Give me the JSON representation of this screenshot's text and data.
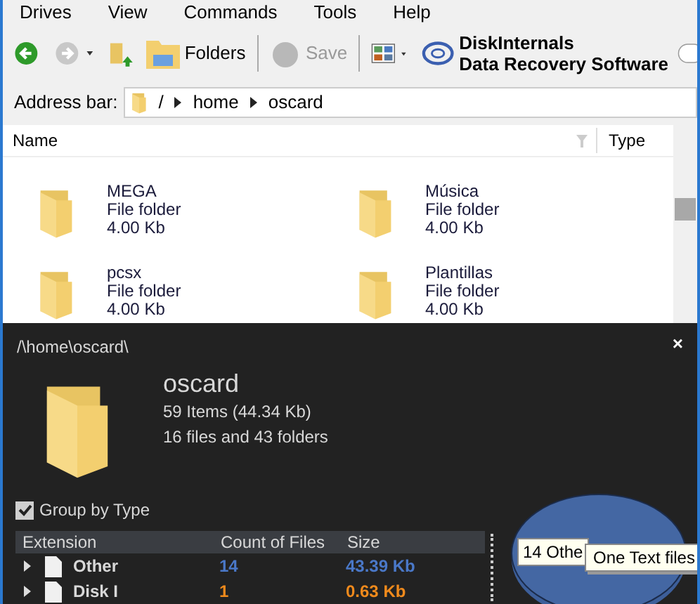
{
  "menu": [
    "Drives",
    "View",
    "Commands",
    "Tools",
    "Help"
  ],
  "toolbar": {
    "folders": "Folders",
    "save": "Save",
    "brand_line1": "DiskInternals",
    "brand_line2": "Data Recovery Software"
  },
  "address_bar": {
    "label": "Address bar:",
    "crumbs": [
      "/",
      "home",
      "oscard"
    ]
  },
  "columns": [
    "Name",
    "Type"
  ],
  "files": [
    {
      "name": "MEGA",
      "type": "File folder",
      "size": "4.00 Kb"
    },
    {
      "name": "Música",
      "type": "File folder",
      "size": "4.00 Kb"
    },
    {
      "name": "pcsx",
      "type": "File folder",
      "size": "4.00 Kb"
    },
    {
      "name": "Plantillas",
      "type": "File folder",
      "size": "4.00 Kb"
    }
  ],
  "details": {
    "close": "×",
    "path": "/\\home\\oscard\\",
    "title": "oscard",
    "items": "59 Items (44.34 Kb)",
    "summary": "16 files and 43 folders",
    "group_by_type": {
      "label": "Group by Type",
      "checked": true
    },
    "table_columns": [
      "Extension",
      "Count of Files",
      "Size"
    ],
    "rows": [
      {
        "name": "Other",
        "count": "14",
        "size": "43.39 Kb",
        "color": "#4a78c8"
      },
      {
        "name": "Disk I",
        "count": "1",
        "size": "0.63 Kb",
        "color": "#f08a1c"
      }
    ],
    "pie_labels": [
      "14 Othe",
      "One Text files"
    ]
  }
}
